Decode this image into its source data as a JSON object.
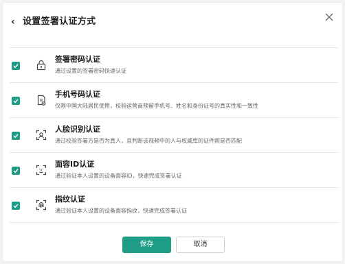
{
  "header": {
    "back_symbol": "‹",
    "title": "设置签署认证方式"
  },
  "options": [
    {
      "title": "签署密码认证",
      "desc": "通过设置的签署密码快速认证",
      "checked": true,
      "icon": "lock-icon"
    },
    {
      "title": "手机号码认证",
      "desc": "仅限中国大陆居民使用，校验运营商预留手机号、姓名和身份证号的真实性和一致性",
      "checked": true,
      "icon": "phone-doc-icon"
    },
    {
      "title": "人脸识别认证",
      "desc": "通过校验签署方是否为真人，且判断该视频中的人与权威库的证件照是否匹配",
      "checked": true,
      "icon": "face-scan-icon"
    },
    {
      "title": "面容ID认证",
      "desc": "通过验证本人设置的设备面容ID，快速完成签署认证",
      "checked": true,
      "icon": "face-id-icon"
    },
    {
      "title": "指纹认证",
      "desc": "通过验证本人设置的设备面容指纹，快速完成签署认证",
      "checked": true,
      "icon": "fingerprint-icon"
    }
  ],
  "footer": {
    "save_label": "保存",
    "cancel_label": "取消"
  },
  "colors": {
    "accent": "#1e9c86"
  }
}
